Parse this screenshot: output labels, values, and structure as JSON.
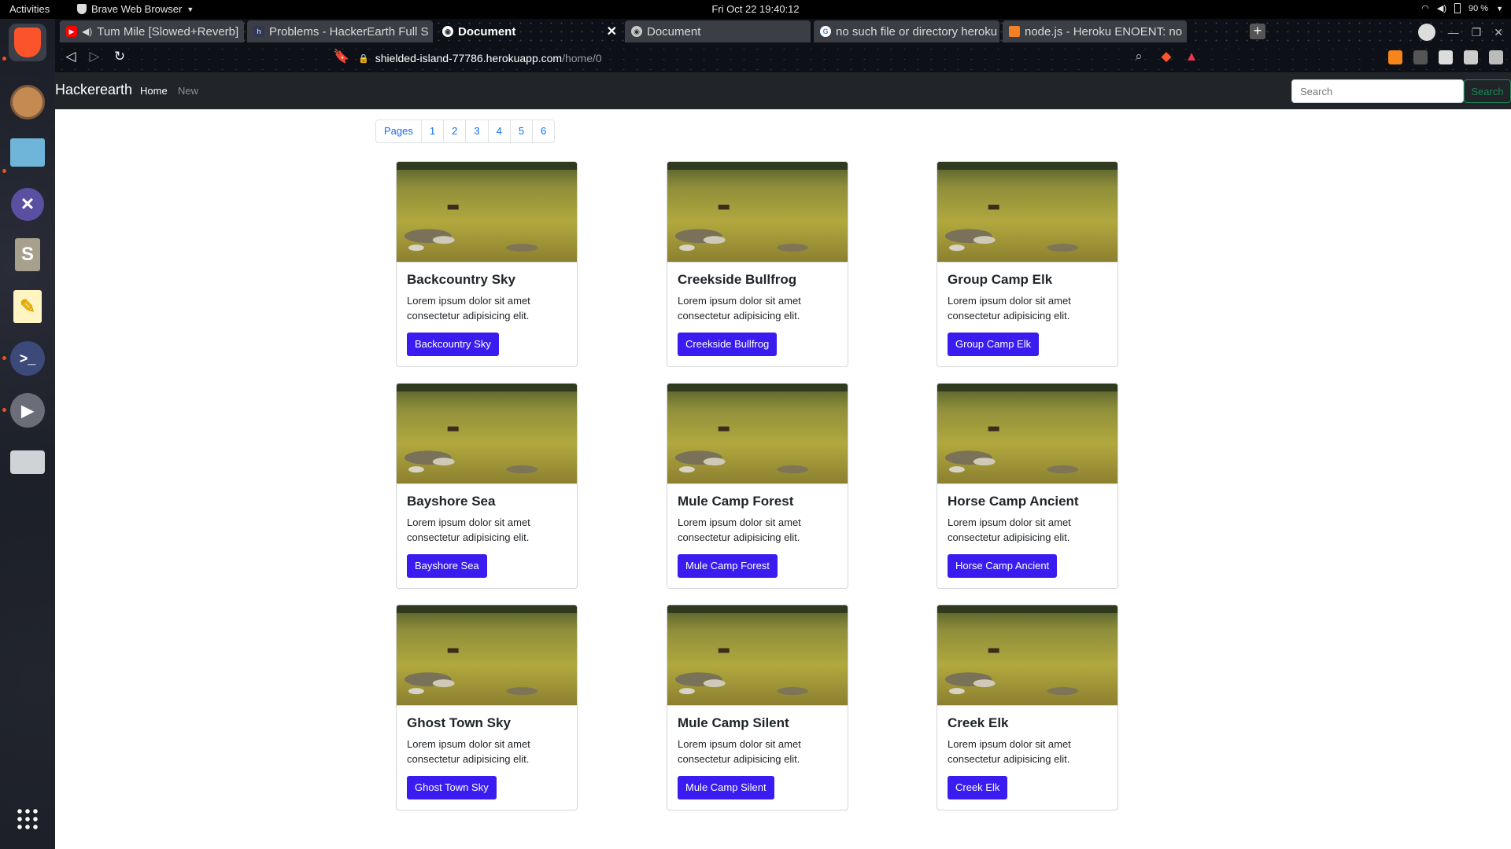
{
  "topbar": {
    "activities": "Activities",
    "app_name": "Brave Web Browser",
    "clock": "Fri Oct 22  19:40:12",
    "battery": "90 %"
  },
  "dock": {
    "items": [
      "brave-browser-icon",
      "firefox-icon",
      "files-icon",
      "vscode-icon",
      "sublime-icon",
      "text-editor-icon",
      "terminal-icon",
      "media-player-icon",
      "drive-icon"
    ],
    "show_apps": "show-applications-icon"
  },
  "browser": {
    "tabs": [
      {
        "label": "Tum Mile [Slowed+Reverb]",
        "fav_color": "#ff0000"
      },
      {
        "label": "Problems - HackerEarth Full S",
        "fav_color": "#323754"
      },
      {
        "label": "Document",
        "fav_color": "#5f6368",
        "active": true
      },
      {
        "label": "Document",
        "fav_color": "#5f6368"
      },
      {
        "label": "no such file or directory heroku",
        "fav_color": "#4285f4"
      },
      {
        "label": "node.js - Heroku ENOENT: no",
        "fav_color": "#f48024"
      }
    ],
    "new_tab": "+",
    "url_host": "shielded-island-77786.herokuapp.com",
    "url_path": "/home/0"
  },
  "navbar": {
    "brand": "Hackerearth",
    "home": "Home",
    "new": "New",
    "search_placeholder": "Search",
    "search_button": "Search"
  },
  "pagination": [
    "Pages",
    "1",
    "2",
    "3",
    "4",
    "5",
    "6"
  ],
  "cards": [
    {
      "title": "Backcountry Sky",
      "text": "Lorem ipsum dolor sit amet consectetur adipisicing elit.",
      "button": "Backcountry Sky"
    },
    {
      "title": "Creekside Bullfrog",
      "text": "Lorem ipsum dolor sit amet consectetur adipisicing elit.",
      "button": "Creekside Bullfrog"
    },
    {
      "title": "Group Camp Elk",
      "text": "Lorem ipsum dolor sit amet consectetur adipisicing elit.",
      "button": "Group Camp Elk"
    },
    {
      "title": "Bayshore Sea",
      "text": "Lorem ipsum dolor sit amet consectetur adipisicing elit.",
      "button": "Bayshore Sea"
    },
    {
      "title": "Mule Camp Forest",
      "text": "Lorem ipsum dolor sit amet consectetur adipisicing elit.",
      "button": "Mule Camp Forest"
    },
    {
      "title": "Horse Camp Ancient",
      "text": "Lorem ipsum dolor sit amet consectetur adipisicing elit.",
      "button": "Horse Camp Ancient"
    },
    {
      "title": "Ghost Town Sky",
      "text": "Lorem ipsum dolor sit amet consectetur adipisicing elit.",
      "button": "Ghost Town Sky"
    },
    {
      "title": "Mule Camp Silent",
      "text": "Lorem ipsum dolor sit amet consectetur adipisicing elit.",
      "button": "Mule Camp Silent"
    },
    {
      "title": "Creek Elk",
      "text": "Lorem ipsum dolor sit amet consectetur adipisicing elit.",
      "button": "Creek Elk"
    }
  ],
  "colors": {
    "button_bg": "#3a1cf0",
    "navbar_bg": "#212529",
    "search_green": "#198754"
  }
}
